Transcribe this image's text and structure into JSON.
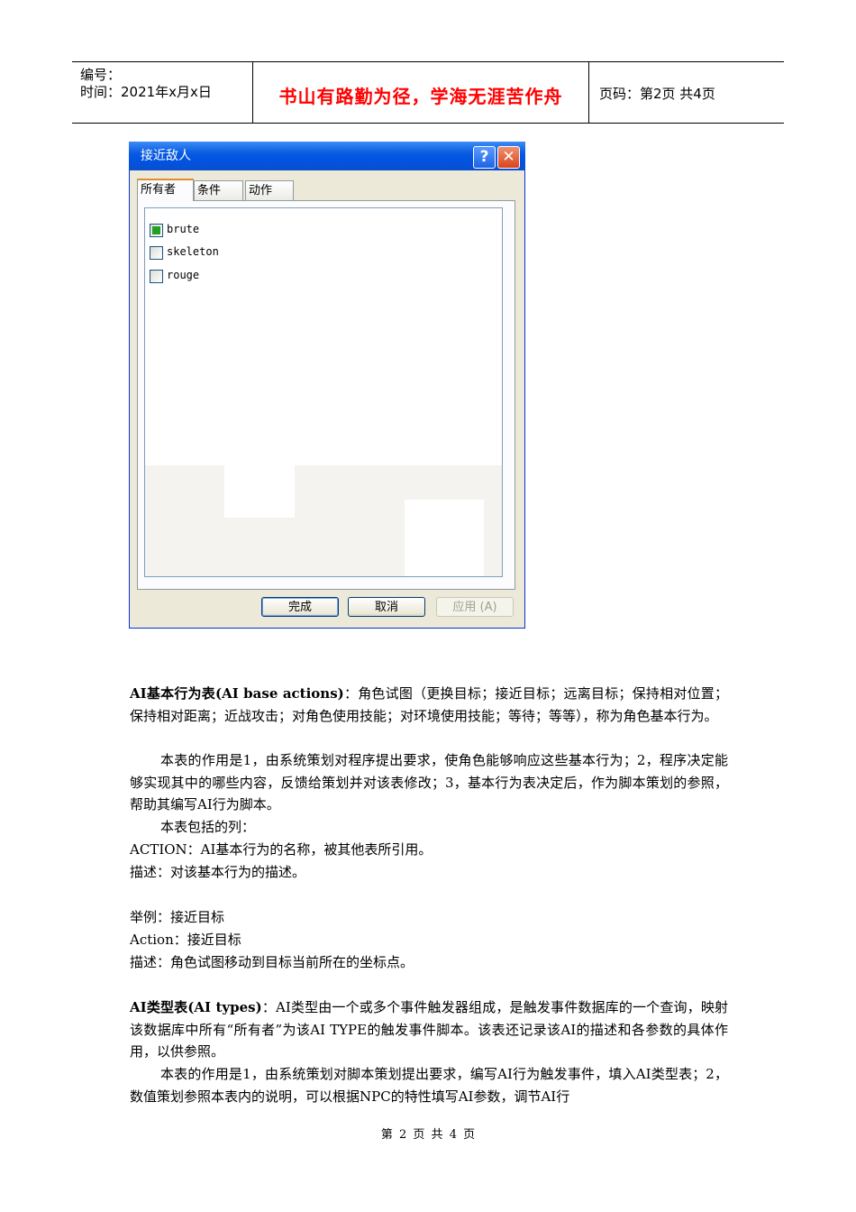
{
  "header": {
    "number_label": "编号：",
    "time_label": "时间：2021年x月x日",
    "motto": "书山有路勤为径，学海无涯苦作舟",
    "page_info": "页码：第2页 共4页"
  },
  "dialog": {
    "title": "接近敌人",
    "help_glyph": "?",
    "close_glyph": "✕",
    "tabs": [
      "所有者",
      "条件",
      "动作"
    ],
    "items": [
      {
        "label": "brute",
        "checked": true
      },
      {
        "label": "skeleton",
        "checked": false
      },
      {
        "label": "rouge",
        "checked": false
      }
    ],
    "buttons": {
      "ok": "完成",
      "cancel": "取消",
      "apply": "应用 (A)"
    }
  },
  "content": {
    "p1_bold": "AI基本行为表(AI base actions)",
    "p1_text": "：角色试图（更换目标；接近目标；远离目标；保持相对位置；保持相对距离；近战攻击；对角色使用技能；对环境使用技能；等待；等等），称为角色基本行为。",
    "p2": "本表的作用是1，由系统策划对程序提出要求，使角色能够响应这些基本行为；2，程序决定能够实现其中的哪些内容，反馈给策划并对该表修改；3，基本行为表决定后，作为脚本策划的参照，帮助其编写AI行为脚本。",
    "p3": "本表包括的列：",
    "p4": "ACTION：AI基本行为的名称，被其他表所引用。",
    "p5": "描述：对该基本行为的描述。",
    "p6": "举例：接近目标",
    "p7": "Action：接近目标",
    "p8": "描述：角色试图移动到目标当前所在的坐标点。",
    "p9_bold": "AI类型表(AI types)",
    "p9_text": "：AI类型由一个或多个事件触发器组成，是触发事件数据库的一个查询，映射该数据库中所有“所有者”为该AI TYPE的触发事件脚本。该表还记录该AI的描述和各参数的具体作用，以供参照。",
    "p10": "本表的作用是1，由系统策划对脚本策划提出要求，编写AI行为触发事件，填入AI类型表；2，数值策划参照本表内的说明，可以根据NPC的特性填写AI参数，调节AI行"
  },
  "footer": "第 2 页 共 4 页"
}
